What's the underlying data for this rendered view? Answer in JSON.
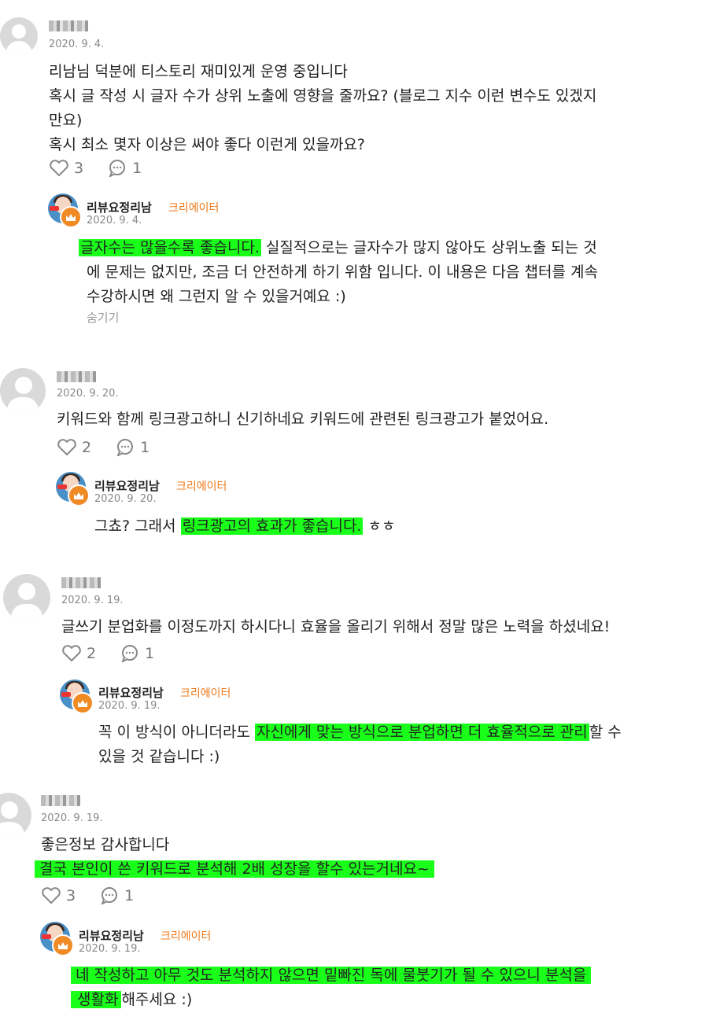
{
  "badge_label": "크리에이터",
  "reply_author": "리뷰요정리남",
  "hide_label": "숨기기",
  "colors": {
    "highlight": "#1aff1a",
    "badge": "#f07a1a",
    "date": "#888888"
  },
  "comments": [
    {
      "date": "2020. 9. 4.",
      "lines": [
        "리남님 덕분에 티스토리 재미있게 운영 중입니다",
        "혹시 글 작성 시 글자 수가 상위 노출에 영향을 줄까요? (블로그 지수 이런 변수도 있겠지",
        "만요)",
        "혹시 최소 몇자 이상은 써야 좋다 이런게 있을까요?"
      ],
      "likes": "3",
      "replies": "1",
      "reply": {
        "date": "2020. 9. 4.",
        "line1_hl": "글자수는 많을수록 좋습니다.",
        "line1_rest": " 실질적으로는 글자수가 많지 않아도 상위노출 되는 것",
        "line2": "에 문제는 없지만, 조금 더 안전하게 하기 위함 입니다. 이 내용은 다음 챕터를 계속",
        "line3": "수강하시면 왜 그런지 알 수 있을거예요 :)"
      }
    },
    {
      "date": "2020. 9. 20.",
      "lines": [
        "키워드와 함께 링크광고하니 신기하네요 키워드에 관련된 링크광고가 붙었어요."
      ],
      "likes": "2",
      "replies": "1",
      "reply": {
        "date": "2020. 9. 20.",
        "pre": "그쵸? 그래서 ",
        "hl": "링크광고의 효과가 좋습니다.",
        "post": " ㅎㅎ"
      }
    },
    {
      "date": "2020. 9. 19.",
      "lines": [
        "글쓰기 분업화를 이정도까지 하시다니 효율을 올리기 위해서 정말 많은 노력을 하셨네요!"
      ],
      "likes": "2",
      "replies": "1",
      "reply": {
        "date": "2020. 9. 19.",
        "pre": "꼭 이 방식이 아니더라도 ",
        "hl": "자신에게 맞는 방식으로 분업하면 더 효율적으로 관리",
        "post": "할 수",
        "line2": "있을 것 같습니다 :)"
      }
    },
    {
      "date": "2020. 9. 19.",
      "line1": "좋은정보 감사합니다",
      "line2_hl": "결국 본인이 쓴 키워드로 분석해 2배 성장을 할수 있는거네요~",
      "likes": "3",
      "replies": "1",
      "reply": {
        "date": "2020. 9. 19.",
        "line1_hl": "네 작성하고 아무 것도 분석하지 않으면 밑빠진 독에 물붓기가 될 수 있으니 분석을",
        "line2_hl": "생활화",
        "line2_rest": "해주세요 :)"
      }
    }
  ]
}
